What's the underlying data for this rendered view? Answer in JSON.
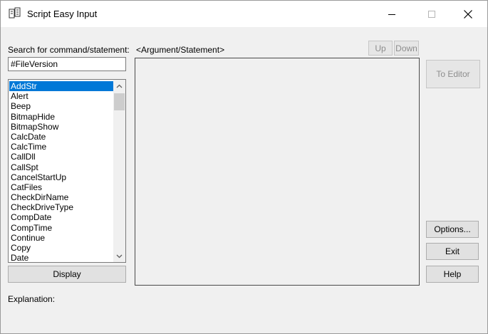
{
  "window": {
    "title": "Script Easy Input",
    "controls": {
      "minimize_icon": "minimize-icon",
      "maximize_icon": "maximize-icon",
      "close_icon": "close-icon"
    }
  },
  "search": {
    "label": "Search for command/statement:",
    "value": "#FileVersion"
  },
  "commands": {
    "selected": "AddStr",
    "items": [
      "AddStr",
      "Alert",
      "Beep",
      "BitmapHide",
      "BitmapShow",
      "CalcDate",
      "CalcTime",
      "CallDll",
      "CallSpt",
      "CancelStartUp",
      "CatFiles",
      "CheckDirName",
      "CheckDriveType",
      "CompDate",
      "CompTime",
      "Continue",
      "Copy",
      "Date"
    ]
  },
  "argument": {
    "label": "<Argument/Statement>",
    "up_label": "Up",
    "down_label": "Down"
  },
  "buttons": {
    "display": "Display",
    "to_editor": "To Editor",
    "options": "Options...",
    "exit": "Exit",
    "help": "Help"
  },
  "explanation": {
    "label": "Explanation:"
  },
  "colors": {
    "selection": "#0078d7",
    "window_bg": "#f0f0f0",
    "disabled_text": "#8d8d8d"
  }
}
